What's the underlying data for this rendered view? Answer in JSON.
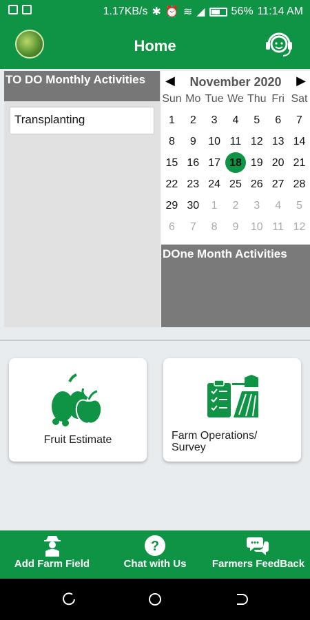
{
  "status_bar": {
    "speed": "1.17KB/s",
    "battery": "56%",
    "time": "11:14 AM"
  },
  "app_bar": {
    "title": "Home"
  },
  "todo": {
    "heading": "TO DO Monthly Activities",
    "items": [
      "Transplanting"
    ]
  },
  "calendar": {
    "month_label": "November 2020",
    "weekdays": [
      "Sun",
      "Mo",
      "Tue",
      "We",
      "Thu",
      "Fri",
      "Sat"
    ],
    "rows": [
      [
        "1",
        "2",
        "3",
        "4",
        "5",
        "6",
        "7"
      ],
      [
        "8",
        "9",
        "10",
        "11",
        "12",
        "13",
        "14"
      ],
      [
        "15",
        "16",
        "17",
        "18",
        "19",
        "20",
        "21"
      ],
      [
        "22",
        "23",
        "24",
        "25",
        "26",
        "27",
        "28"
      ],
      [
        "29",
        "30",
        "1",
        "2",
        "3",
        "4",
        "5"
      ],
      [
        "6",
        "7",
        "8",
        "9",
        "10",
        "11",
        "12"
      ]
    ],
    "selected_day": "18",
    "accent": "#0e9444"
  },
  "done": {
    "heading": "DOne Month Activities"
  },
  "cards": {
    "fruit": {
      "label": "Fruit Estimate"
    },
    "farm_ops": {
      "label_line1": "Farm Operations/",
      "label_line2": "Survey"
    }
  },
  "bottom_nav": {
    "add_field": "Add Farm Field",
    "chat": "Chat with Us",
    "feedback": "Farmers FeedBack"
  },
  "colors": {
    "primary": "#0e9444",
    "header_gray": "#777777"
  }
}
